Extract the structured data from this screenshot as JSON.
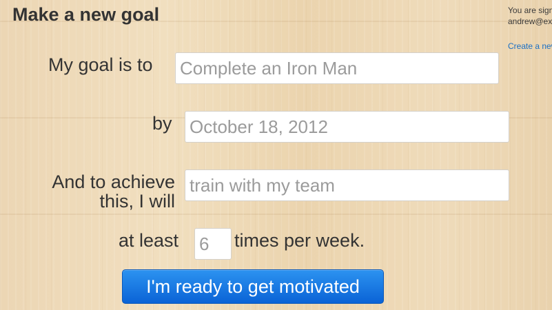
{
  "page": {
    "title": "Make a new goal"
  },
  "account": {
    "signed_in_text": "You are signed in as",
    "email": "andrew@example.com",
    "create_link": "Create a new goal"
  },
  "form": {
    "goal_label": "My goal is to",
    "goal_placeholder": "Complete an Iron Man",
    "date_label": "by",
    "date_placeholder": "October 18, 2012",
    "action_label_line1": "And to achieve",
    "action_label_line2": "this, I will",
    "action_placeholder": "train with my team",
    "frequency_prefix": "at least",
    "frequency_placeholder": "6",
    "frequency_suffix": "times per week.",
    "submit_label": "I'm ready to get motivated"
  },
  "colors": {
    "accent": "#0a63d6",
    "link": "#1a6fc4",
    "text": "#333333"
  }
}
